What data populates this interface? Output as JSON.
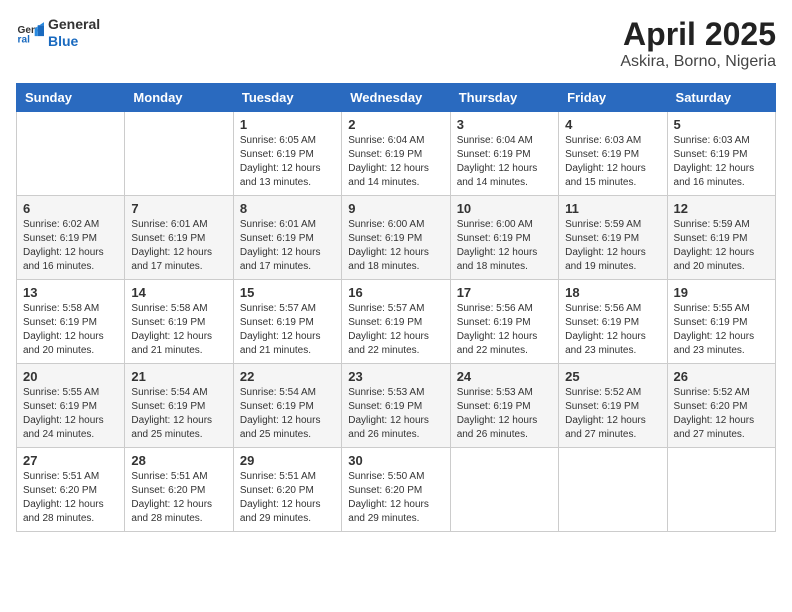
{
  "header": {
    "logo_general": "General",
    "logo_blue": "Blue",
    "title": "April 2025",
    "subtitle": "Askira, Borno, Nigeria"
  },
  "days_of_week": [
    "Sunday",
    "Monday",
    "Tuesday",
    "Wednesday",
    "Thursday",
    "Friday",
    "Saturday"
  ],
  "weeks": [
    [
      {
        "day": "",
        "info": ""
      },
      {
        "day": "",
        "info": ""
      },
      {
        "day": "1",
        "info": "Sunrise: 6:05 AM\nSunset: 6:19 PM\nDaylight: 12 hours and 13 minutes."
      },
      {
        "day": "2",
        "info": "Sunrise: 6:04 AM\nSunset: 6:19 PM\nDaylight: 12 hours and 14 minutes."
      },
      {
        "day": "3",
        "info": "Sunrise: 6:04 AM\nSunset: 6:19 PM\nDaylight: 12 hours and 14 minutes."
      },
      {
        "day": "4",
        "info": "Sunrise: 6:03 AM\nSunset: 6:19 PM\nDaylight: 12 hours and 15 minutes."
      },
      {
        "day": "5",
        "info": "Sunrise: 6:03 AM\nSunset: 6:19 PM\nDaylight: 12 hours and 16 minutes."
      }
    ],
    [
      {
        "day": "6",
        "info": "Sunrise: 6:02 AM\nSunset: 6:19 PM\nDaylight: 12 hours and 16 minutes."
      },
      {
        "day": "7",
        "info": "Sunrise: 6:01 AM\nSunset: 6:19 PM\nDaylight: 12 hours and 17 minutes."
      },
      {
        "day": "8",
        "info": "Sunrise: 6:01 AM\nSunset: 6:19 PM\nDaylight: 12 hours and 17 minutes."
      },
      {
        "day": "9",
        "info": "Sunrise: 6:00 AM\nSunset: 6:19 PM\nDaylight: 12 hours and 18 minutes."
      },
      {
        "day": "10",
        "info": "Sunrise: 6:00 AM\nSunset: 6:19 PM\nDaylight: 12 hours and 18 minutes."
      },
      {
        "day": "11",
        "info": "Sunrise: 5:59 AM\nSunset: 6:19 PM\nDaylight: 12 hours and 19 minutes."
      },
      {
        "day": "12",
        "info": "Sunrise: 5:59 AM\nSunset: 6:19 PM\nDaylight: 12 hours and 20 minutes."
      }
    ],
    [
      {
        "day": "13",
        "info": "Sunrise: 5:58 AM\nSunset: 6:19 PM\nDaylight: 12 hours and 20 minutes."
      },
      {
        "day": "14",
        "info": "Sunrise: 5:58 AM\nSunset: 6:19 PM\nDaylight: 12 hours and 21 minutes."
      },
      {
        "day": "15",
        "info": "Sunrise: 5:57 AM\nSunset: 6:19 PM\nDaylight: 12 hours and 21 minutes."
      },
      {
        "day": "16",
        "info": "Sunrise: 5:57 AM\nSunset: 6:19 PM\nDaylight: 12 hours and 22 minutes."
      },
      {
        "day": "17",
        "info": "Sunrise: 5:56 AM\nSunset: 6:19 PM\nDaylight: 12 hours and 22 minutes."
      },
      {
        "day": "18",
        "info": "Sunrise: 5:56 AM\nSunset: 6:19 PM\nDaylight: 12 hours and 23 minutes."
      },
      {
        "day": "19",
        "info": "Sunrise: 5:55 AM\nSunset: 6:19 PM\nDaylight: 12 hours and 23 minutes."
      }
    ],
    [
      {
        "day": "20",
        "info": "Sunrise: 5:55 AM\nSunset: 6:19 PM\nDaylight: 12 hours and 24 minutes."
      },
      {
        "day": "21",
        "info": "Sunrise: 5:54 AM\nSunset: 6:19 PM\nDaylight: 12 hours and 25 minutes."
      },
      {
        "day": "22",
        "info": "Sunrise: 5:54 AM\nSunset: 6:19 PM\nDaylight: 12 hours and 25 minutes."
      },
      {
        "day": "23",
        "info": "Sunrise: 5:53 AM\nSunset: 6:19 PM\nDaylight: 12 hours and 26 minutes."
      },
      {
        "day": "24",
        "info": "Sunrise: 5:53 AM\nSunset: 6:19 PM\nDaylight: 12 hours and 26 minutes."
      },
      {
        "day": "25",
        "info": "Sunrise: 5:52 AM\nSunset: 6:19 PM\nDaylight: 12 hours and 27 minutes."
      },
      {
        "day": "26",
        "info": "Sunrise: 5:52 AM\nSunset: 6:20 PM\nDaylight: 12 hours and 27 minutes."
      }
    ],
    [
      {
        "day": "27",
        "info": "Sunrise: 5:51 AM\nSunset: 6:20 PM\nDaylight: 12 hours and 28 minutes."
      },
      {
        "day": "28",
        "info": "Sunrise: 5:51 AM\nSunset: 6:20 PM\nDaylight: 12 hours and 28 minutes."
      },
      {
        "day": "29",
        "info": "Sunrise: 5:51 AM\nSunset: 6:20 PM\nDaylight: 12 hours and 29 minutes."
      },
      {
        "day": "30",
        "info": "Sunrise: 5:50 AM\nSunset: 6:20 PM\nDaylight: 12 hours and 29 minutes."
      },
      {
        "day": "",
        "info": ""
      },
      {
        "day": "",
        "info": ""
      },
      {
        "day": "",
        "info": ""
      }
    ]
  ]
}
